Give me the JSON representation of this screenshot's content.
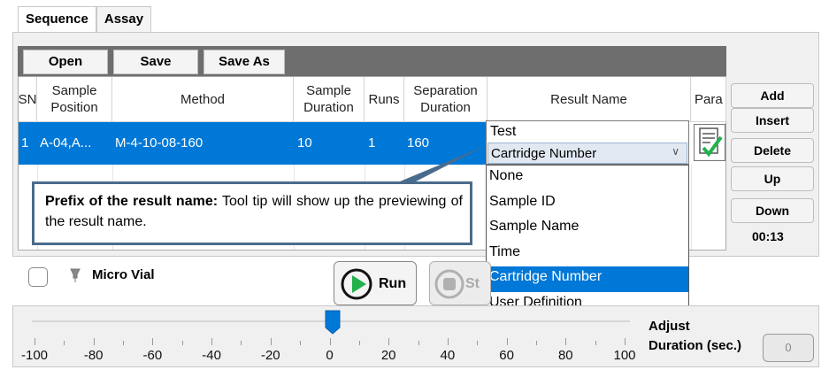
{
  "tabs": [
    {
      "label": "Sequence",
      "active": true
    },
    {
      "label": "Assay",
      "active": false
    }
  ],
  "toolbar": {
    "open_label": "Open",
    "save_label": "Save",
    "save_as_label": "Save As"
  },
  "table": {
    "headers": [
      "SN",
      "Sample Position",
      "Method",
      "Sample Duration",
      "Runs",
      "Separation Duration",
      "Result Name",
      "Para"
    ],
    "rows": [
      {
        "sn": "1",
        "sample_position": "A-04,A...",
        "method": "M-4-10-08-160",
        "sample_duration": "10",
        "runs": "1",
        "separation_duration": "160",
        "result_name_text": "Test",
        "result_name_prefix": "Cartridge Number"
      }
    ]
  },
  "dropdown": {
    "options": [
      "None",
      "Sample ID",
      "Sample Name",
      "Time",
      "Cartridge Number",
      "User Definition"
    ],
    "selected": "Cartridge Number"
  },
  "side_buttons": {
    "add": "Add",
    "insert": "Insert",
    "delete": "Delete",
    "up": "Up",
    "down": "Down"
  },
  "timer": "00:13",
  "callout": {
    "bold": "Prefix of the result name:",
    "text": " Tool tip will show up the previewing of the result name."
  },
  "controls": {
    "micro_vial_label": "Micro Vial",
    "run_label": "Run",
    "stop_label": "St"
  },
  "slider": {
    "tick_labels": [
      "-100",
      "-80",
      "-60",
      "-40",
      "-20",
      "0",
      "20",
      "40",
      "60",
      "80",
      "100"
    ],
    "value": 0,
    "adjust_label_line1": "Adjust",
    "adjust_label_line2": "Duration (sec.)",
    "duration_value": "0"
  },
  "colors": {
    "selection": "#0078d7",
    "toolbar": "#6e6e6e",
    "callout_border": "#4a6c8c",
    "run_green": "#22b14c"
  }
}
